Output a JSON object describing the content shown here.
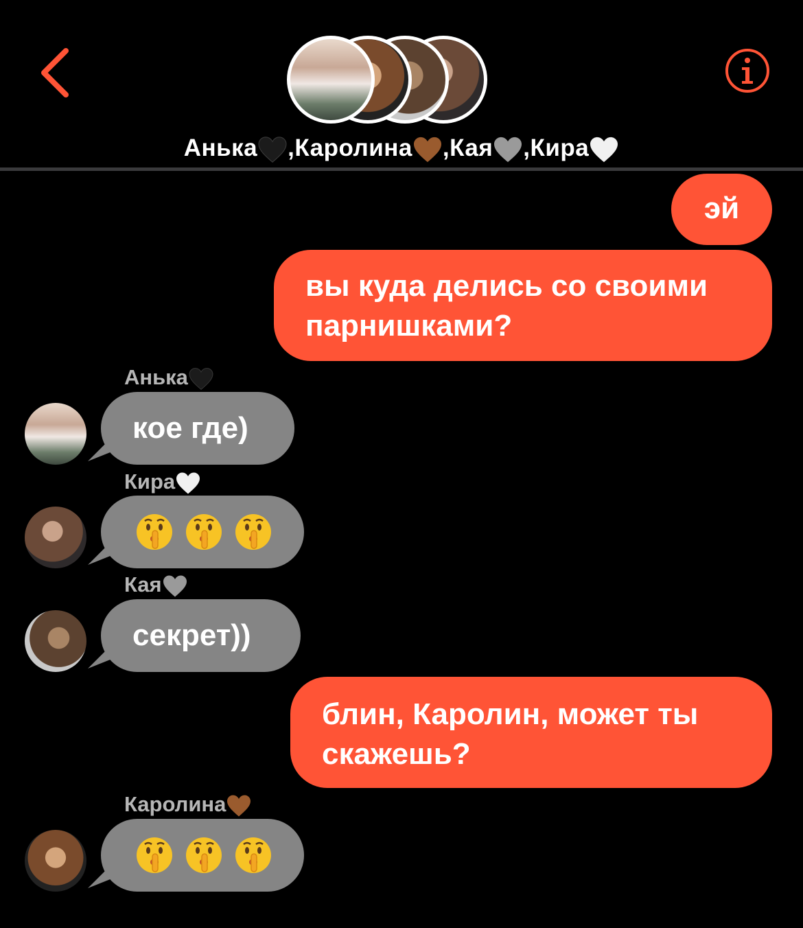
{
  "header": {
    "back_icon": "chevron-left-icon",
    "info_icon": "info-icon",
    "group_names": [
      {
        "name": "Анька",
        "heart": "black"
      },
      {
        "name": ",Каролина",
        "heart": "brown"
      },
      {
        "name": ",Кая",
        "heart": "grey"
      },
      {
        "name": ",Кира",
        "heart": "white"
      }
    ]
  },
  "colors": {
    "accent": "#ff5436",
    "incoming_bubble": "#858585",
    "background": "#000000",
    "sender_name": "#b6b6b6"
  },
  "messages": [
    {
      "id": "m1",
      "direction": "outgoing",
      "text": "эй"
    },
    {
      "id": "m2",
      "direction": "outgoing",
      "lines": [
        "вы куда делись со своими",
        "парнишками?"
      ]
    },
    {
      "id": "m3",
      "direction": "incoming",
      "sender": "Анька",
      "sender_heart": "black",
      "text": "кое где)"
    },
    {
      "id": "m4",
      "direction": "incoming",
      "sender": "Кира",
      "sender_heart": "white",
      "emoji": [
        "shushing-face",
        "shushing-face",
        "shushing-face"
      ]
    },
    {
      "id": "m5",
      "direction": "incoming",
      "sender": "Кая",
      "sender_heart": "grey",
      "text": "секрет))"
    },
    {
      "id": "m6",
      "direction": "outgoing",
      "lines": [
        "блин, Каролин, может ты",
        "скажешь?"
      ]
    },
    {
      "id": "m7",
      "direction": "incoming",
      "sender": "Каролина",
      "sender_heart": "brown",
      "emoji": [
        "shushing-face",
        "shushing-face",
        "shushing-face"
      ]
    }
  ]
}
